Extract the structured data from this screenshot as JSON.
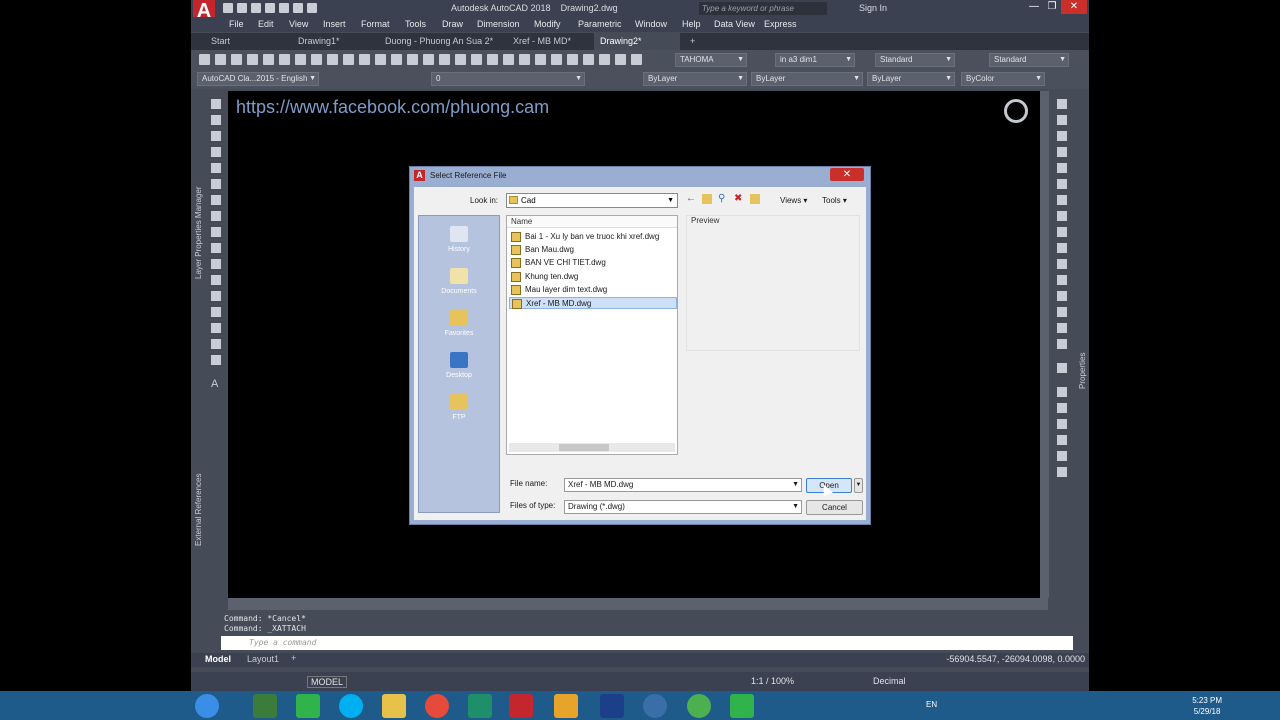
{
  "app": {
    "title": "Autodesk AutoCAD 2018",
    "document": "Drawing2.dwg",
    "search_placeholder": "Type a keyword or phrase",
    "signin": "Sign In",
    "logo_color": "#c4262e"
  },
  "menu": [
    "File",
    "Edit",
    "View",
    "Insert",
    "Format",
    "Tools",
    "Draw",
    "Dimension",
    "Modify",
    "Parametric",
    "Window",
    "Help",
    "Data View",
    "Express"
  ],
  "doc_tabs": [
    "Start",
    "Drawing1*",
    "Duong - Phuong An Sua 2*",
    "Xref - MB MD*",
    "Drawing2*"
  ],
  "toolbar": {
    "font": "TAHOMA",
    "dimstyle": "in a3 dim1",
    "textstyle": "Standard",
    "tablestyle": "Standard",
    "workspace": "AutoCAD Cla...2015 - English",
    "layer": "0",
    "color": "ByLayer",
    "linetype": "ByLayer",
    "lineweight": "ByLayer",
    "plotstyle": "ByColor"
  },
  "canvas": {
    "url_text": "https://www.facebook.com/phuong.cam"
  },
  "side_palettes": {
    "layer_props": "Layer Properties Manager",
    "external_refs": "External References",
    "properties": "Properties"
  },
  "command": {
    "history": [
      "Command: *Cancel*",
      "Command: _XATTACH"
    ],
    "placeholder": "Type a command"
  },
  "layout_tabs": [
    "Model",
    "Layout1"
  ],
  "coordinates": "-56904.5547, -26094.0098, 0.0000",
  "status": {
    "model": "MODEL",
    "scale": "1:1 / 100%",
    "units": "Decimal"
  },
  "dialog": {
    "title": "Select Reference File",
    "look_in_label": "Look in:",
    "look_in_value": "Cad",
    "views": "Views",
    "tools": "Tools",
    "places": [
      "History",
      "Documents",
      "Favorites",
      "Desktop",
      "FTP"
    ],
    "column_name": "Name",
    "files": [
      "Bai 1 - Xu ly ban ve truoc khi xref.dwg",
      "Ban Mau.dwg",
      "BAN VE CHI TIET.dwg",
      "Khung ten.dwg",
      "Mau layer dim text.dwg",
      "Xref - MB MD.dwg"
    ],
    "preview_label": "Preview",
    "file_name_label": "File name:",
    "file_name_value": "Xref - MB MD.dwg",
    "file_type_label": "Files of type:",
    "file_type_value": "Drawing (*.dwg)",
    "open_button": "Open",
    "cancel_button": "Cancel"
  },
  "taskbar": {
    "lang": "EN",
    "time": "5:23 PM",
    "date": "5/29/18"
  }
}
